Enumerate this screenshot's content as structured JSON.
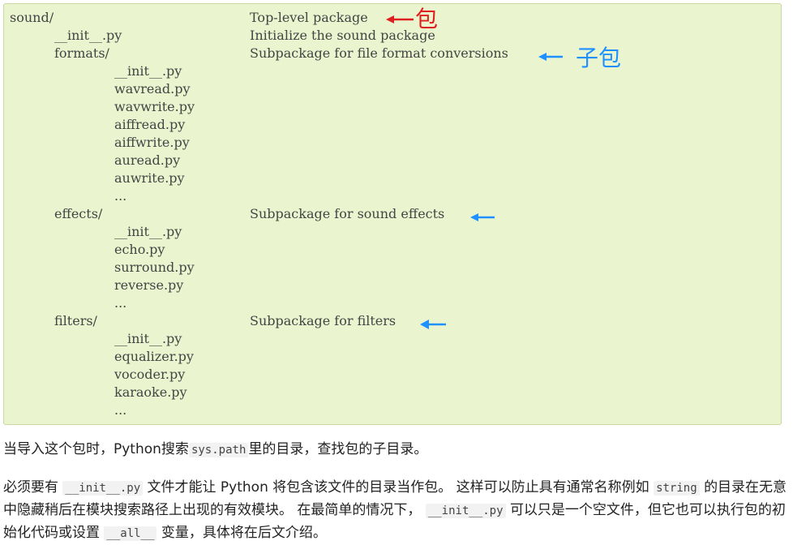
{
  "tree": [
    {
      "indent": 0,
      "name": "sound/",
      "desc": "Top-level package"
    },
    {
      "indent": 1,
      "name": "__init__.py",
      "desc": "Initialize the sound package"
    },
    {
      "indent": 1,
      "name": "formats/",
      "desc": "Subpackage for file format conversions"
    },
    {
      "indent": 2,
      "name": "__init__.py",
      "desc": ""
    },
    {
      "indent": 2,
      "name": "wavread.py",
      "desc": ""
    },
    {
      "indent": 2,
      "name": "wavwrite.py",
      "desc": ""
    },
    {
      "indent": 2,
      "name": "aiffread.py",
      "desc": ""
    },
    {
      "indent": 2,
      "name": "aiffwrite.py",
      "desc": ""
    },
    {
      "indent": 2,
      "name": "auread.py",
      "desc": ""
    },
    {
      "indent": 2,
      "name": "auwrite.py",
      "desc": ""
    },
    {
      "indent": 2,
      "name": "...",
      "desc": ""
    },
    {
      "indent": 1,
      "name": "effects/",
      "desc": "Subpackage for sound effects"
    },
    {
      "indent": 2,
      "name": "__init__.py",
      "desc": ""
    },
    {
      "indent": 2,
      "name": "echo.py",
      "desc": ""
    },
    {
      "indent": 2,
      "name": "surround.py",
      "desc": ""
    },
    {
      "indent": 2,
      "name": "reverse.py",
      "desc": ""
    },
    {
      "indent": 2,
      "name": "...",
      "desc": ""
    },
    {
      "indent": 1,
      "name": "filters/",
      "desc": "Subpackage for filters"
    },
    {
      "indent": 2,
      "name": "__init__.py",
      "desc": ""
    },
    {
      "indent": 2,
      "name": "equalizer.py",
      "desc": ""
    },
    {
      "indent": 2,
      "name": "vocoder.py",
      "desc": ""
    },
    {
      "indent": 2,
      "name": "karaoke.py",
      "desc": ""
    },
    {
      "indent": 2,
      "name": "...",
      "desc": ""
    }
  ],
  "annotations": {
    "package_label": "包",
    "subpackage_label": "子包",
    "package_color": "#e02020",
    "subpackage_color": "#1e90ff"
  },
  "para1": {
    "t1": "当导入这个包时，Python搜索",
    "code1": "sys.path",
    "t2": "里的目录，查找包的子目录。"
  },
  "para2": {
    "t1": "必须要有",
    "code1": "__init__.py",
    "t2": "文件才能让 Python 将包含该文件的目录当作包。 这样可以防止具有通常名称例如",
    "code2": "string",
    "t3": "的目录在无意中隐藏稍后在模块搜索路径上出现的有效模块。 在最简单的情况下，",
    "code3": "__init__.py",
    "t4": "可以只是一个空文件，但它也可以执行包的初始化代码或设置",
    "code4": "__all__",
    "t5": "变量，具体将在后文介绍。"
  }
}
